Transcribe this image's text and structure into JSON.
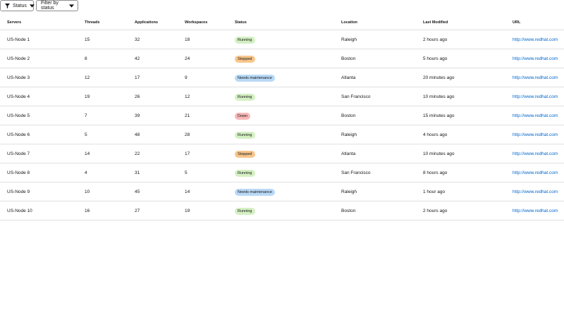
{
  "toolbar": {
    "status_label": "Status",
    "filter_label": "Filter by status"
  },
  "table": {
    "headers": {
      "servers": "Servers",
      "threads": "Threads",
      "applications": "Applications",
      "workspaces": "Workspaces",
      "status": "Status",
      "location": "Location",
      "last_modified": "Last Modified",
      "url": "URL"
    },
    "rows": [
      {
        "server": "US-Node 1",
        "threads": "15",
        "applications": "32",
        "workspaces": "18",
        "status": "Running",
        "status_kind": "running",
        "location": "Raleigh",
        "last_modified": "2 hours ago",
        "url": "http://www.redhat.com"
      },
      {
        "server": "US-Node 2",
        "threads": "8",
        "applications": "42",
        "workspaces": "24",
        "status": "Stopped",
        "status_kind": "stopped",
        "location": "Boston",
        "last_modified": "5 hours ago",
        "url": "http://www.redhat.com"
      },
      {
        "server": "US-Node 3",
        "threads": "12",
        "applications": "17",
        "workspaces": "9",
        "status": "Needs maintenance",
        "status_kind": "maint",
        "location": "Atlanta",
        "last_modified": "20 minutes ago",
        "url": "http://www.redhat.com"
      },
      {
        "server": "US-Node 4",
        "threads": "19",
        "applications": "26",
        "workspaces": "12",
        "status": "Running",
        "status_kind": "running",
        "location": "San Francisco",
        "last_modified": "10 minutes ago",
        "url": "http://www.redhat.com"
      },
      {
        "server": "US-Node 5",
        "threads": "7",
        "applications": "39",
        "workspaces": "21",
        "status": "Down",
        "status_kind": "down",
        "location": "Boston",
        "last_modified": "15 minutes ago",
        "url": "http://www.redhat.com"
      },
      {
        "server": "US-Node 6",
        "threads": "5",
        "applications": "48",
        "workspaces": "28",
        "status": "Running",
        "status_kind": "running",
        "location": "Raleigh",
        "last_modified": "4 hours ago",
        "url": "http://www.redhat.com"
      },
      {
        "server": "US-Node 7",
        "threads": "14",
        "applications": "22",
        "workspaces": "17",
        "status": "Stopped",
        "status_kind": "stopped",
        "location": "Atlanta",
        "last_modified": "10 minutes ago",
        "url": "http://www.redhat.com"
      },
      {
        "server": "US-Node 8",
        "threads": "4",
        "applications": "31",
        "workspaces": "5",
        "status": "Running",
        "status_kind": "running",
        "location": "San Francisco",
        "last_modified": "8 hours ago",
        "url": "http://www.redhat.com"
      },
      {
        "server": "US-Node 9",
        "threads": "10",
        "applications": "45",
        "workspaces": "14",
        "status": "Needs maintenance",
        "status_kind": "maint",
        "location": "Raleigh",
        "last_modified": "1 hour ago",
        "url": "http://www.redhat.com"
      },
      {
        "server": "US-Node 10",
        "threads": "16",
        "applications": "27",
        "workspaces": "19",
        "status": "Running",
        "status_kind": "running",
        "location": "Boston",
        "last_modified": "2 hours ago",
        "url": "http://www.redhat.com"
      }
    ]
  },
  "colors": {
    "running": "#d4f0c3",
    "stopped": "#f8c68c",
    "needs_maintenance": "#b9d9f6",
    "down": "#f9b8b8",
    "link": "#0066cc"
  },
  "icons": {
    "filter": "filter-icon",
    "caret": "caret-down-icon"
  }
}
